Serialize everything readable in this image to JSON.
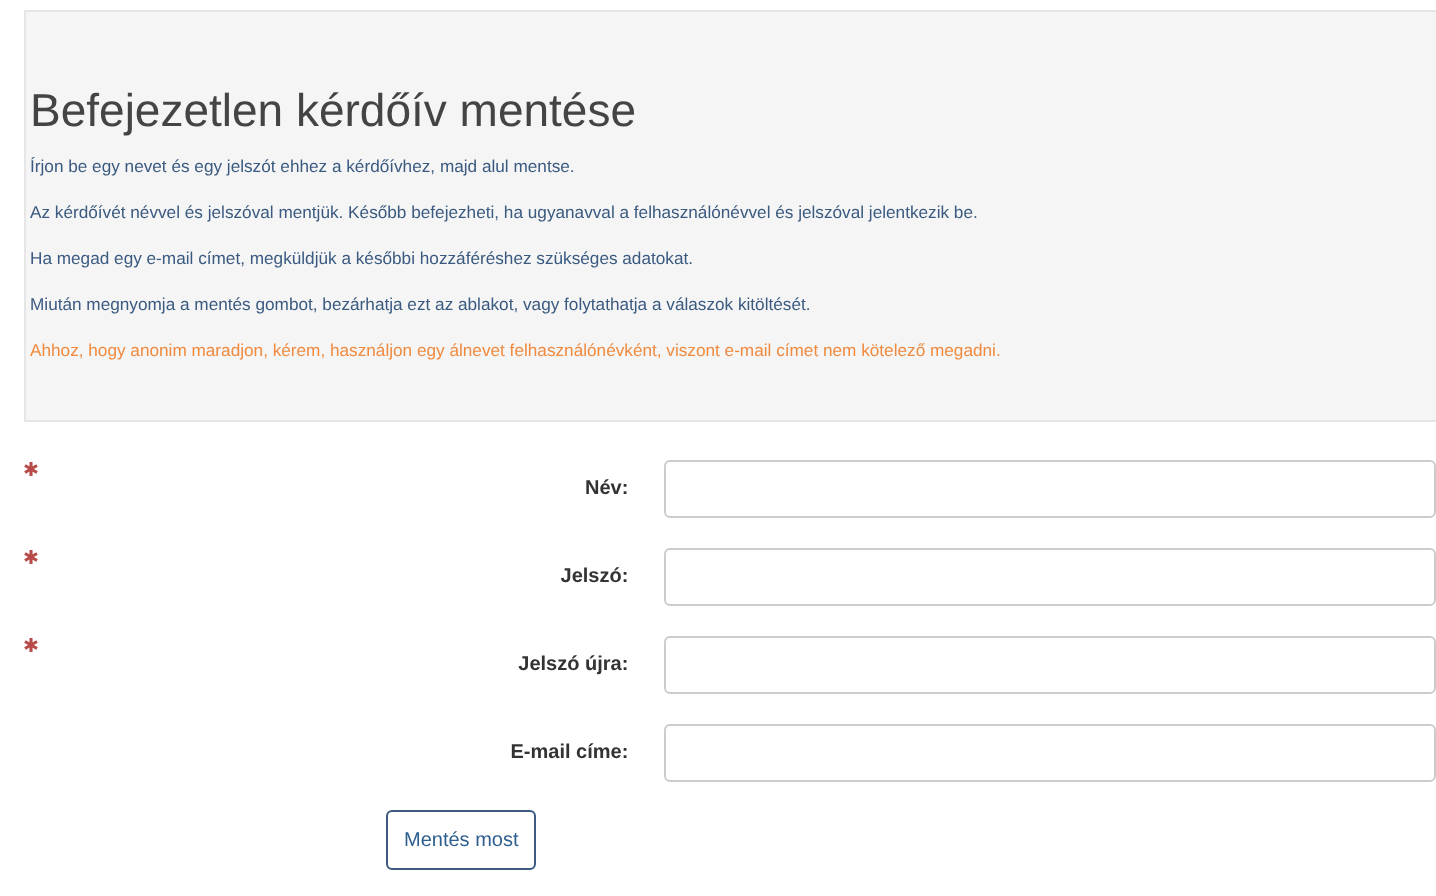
{
  "panel": {
    "title": "Befejezetlen kérdőív mentése",
    "paragraphs": [
      {
        "text": "Írjon be egy nevet és egy jelszót ehhez a kérdőívhez, majd alul mentse.",
        "kind": "info"
      },
      {
        "text": "Az kérdőívét névvel és jelszóval mentjük. Később befejezheti, ha ugyanavval a felhasználónévvel és jelszóval jelentkezik be.",
        "kind": "info"
      },
      {
        "text": "Ha megad egy e-mail címet, megküldjük a későbbi hozzáféréshez szükséges adatokat.",
        "kind": "info"
      },
      {
        "text": "Miután megnyomja a mentés gombot, bezárhatja ezt az ablakot, vagy folytathatja a válaszok kitöltését.",
        "kind": "info"
      },
      {
        "text": "Ahhoz, hogy anonim maradjon, kérem, használjon egy álnevet felhasználónévként, viszont e-mail címet nem kötelező megadni.",
        "kind": "warning"
      }
    ]
  },
  "form": {
    "fields": [
      {
        "label": "Név:",
        "required": true
      },
      {
        "label": "Jelszó:",
        "required": true
      },
      {
        "label": "Jelszó újra:",
        "required": true
      },
      {
        "label": "E-mail címe:",
        "required": false
      }
    ],
    "submit": "Mentés most"
  }
}
